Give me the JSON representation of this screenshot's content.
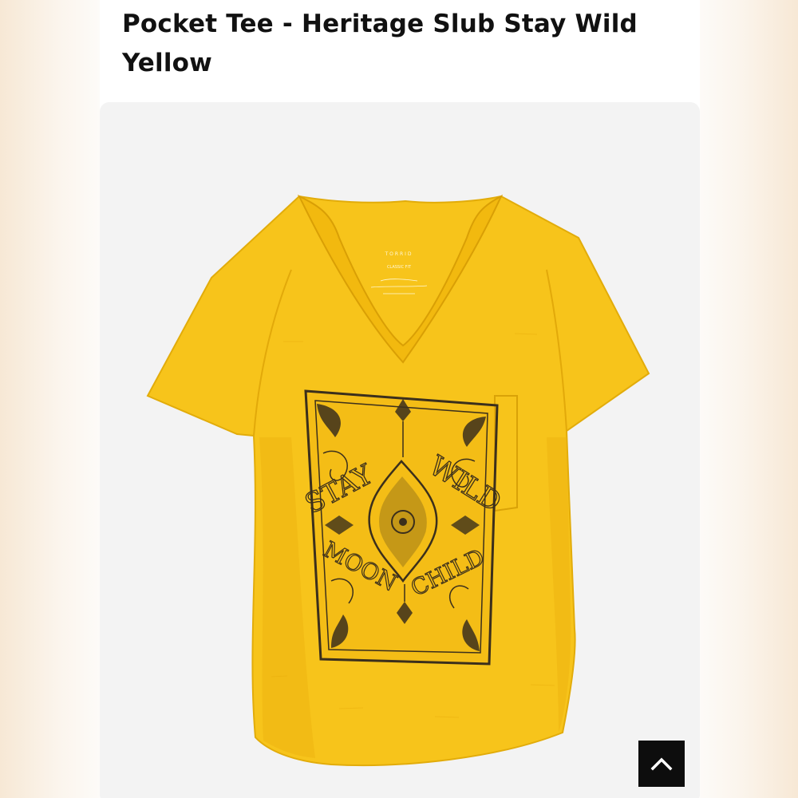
{
  "product": {
    "title": "Pocket Tee - Heritage Slub Stay Wild Yellow"
  },
  "graphic": {
    "line_1_left": "STAY",
    "line_1_right": "WILD",
    "line_2_left": "MOON",
    "line_2_right": "CHILD"
  },
  "neck_label": {
    "brand": "TORRID",
    "fit": "CLASSIC FIT"
  },
  "colors": {
    "shirt": "#f7c41b",
    "ink": "#3b2f1c",
    "scroll_button": "#0d0d0d"
  },
  "icons": {
    "scroll_top": "chevron-up-icon"
  }
}
